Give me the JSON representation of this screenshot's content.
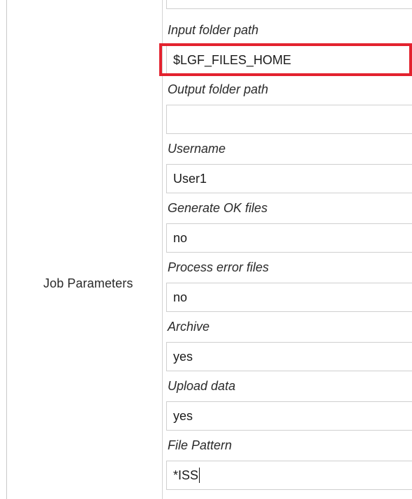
{
  "section": {
    "label": "Job Parameters"
  },
  "params": [
    {
      "label": "Input folder path",
      "value": "$LGF_FILES_HOME"
    },
    {
      "label": "Output folder path",
      "value": ""
    },
    {
      "label": "Username",
      "value": "User1"
    },
    {
      "label": "Generate OK files",
      "value": "no"
    },
    {
      "label": "Process error files",
      "value": "no"
    },
    {
      "label": "Archive",
      "value": "yes"
    },
    {
      "label": "Upload data",
      "value": "yes"
    },
    {
      "label": "File Pattern",
      "value": "*ISS"
    }
  ],
  "colors": {
    "highlight": "#e3222e",
    "border": "#cfcfcf"
  }
}
